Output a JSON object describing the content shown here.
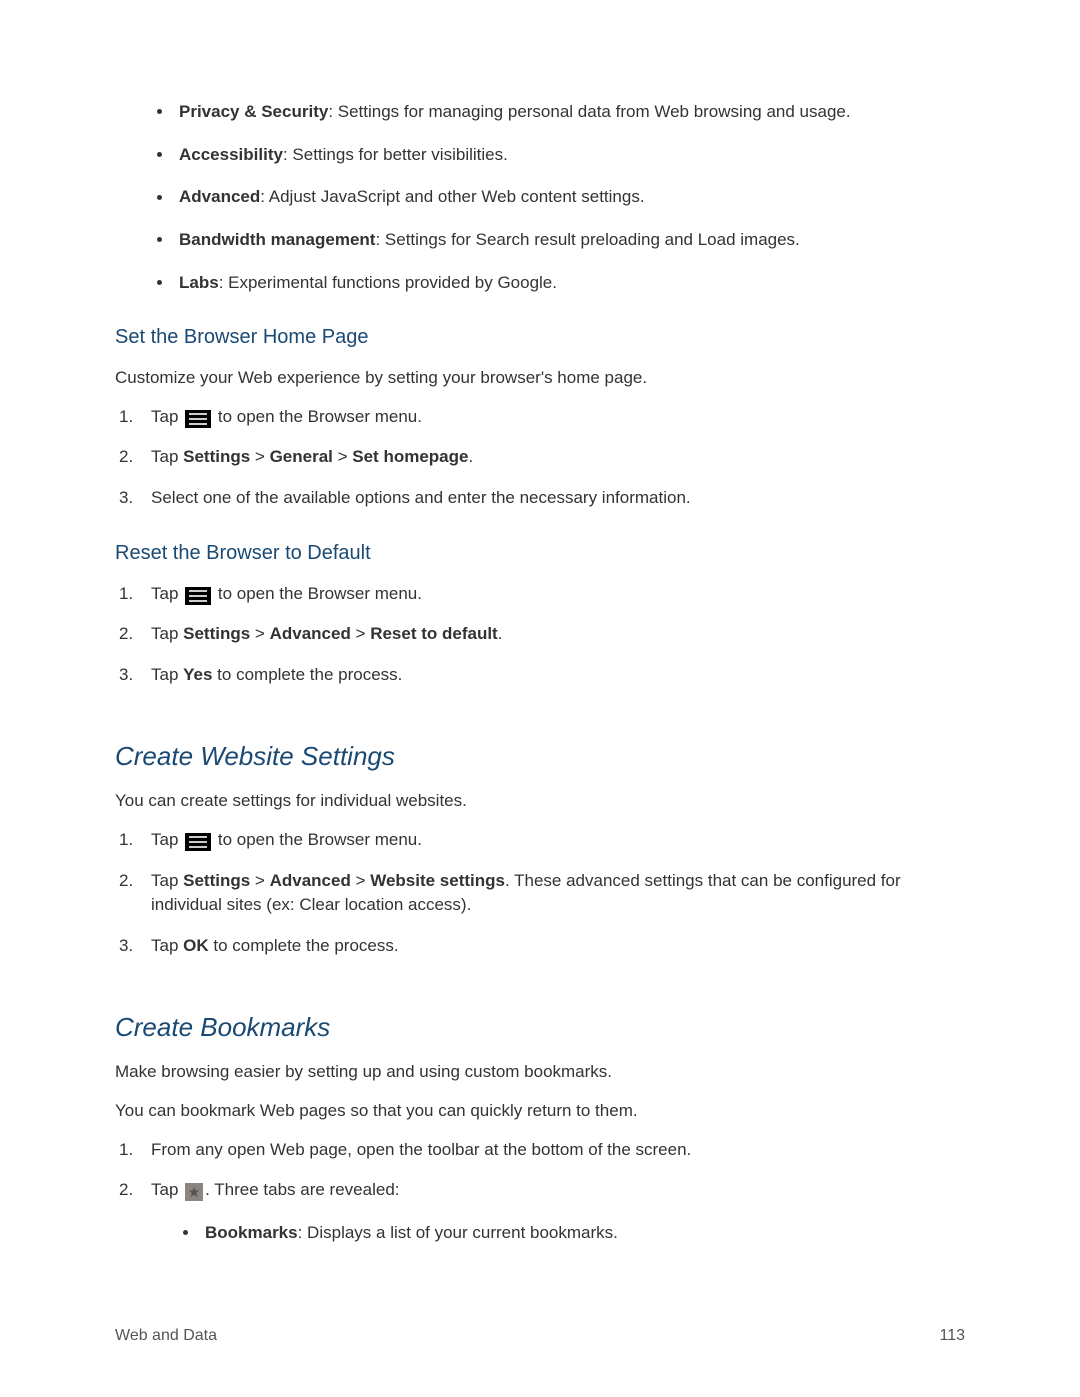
{
  "settings_list": [
    {
      "label": "Privacy & Security",
      "desc": ": Settings for managing personal data from Web browsing and usage."
    },
    {
      "label": "Accessibility",
      "desc": ": Settings for better visibilities."
    },
    {
      "label": "Advanced",
      "desc": ": Adjust JavaScript and other Web content settings."
    },
    {
      "label": "Bandwidth management",
      "desc": ": Settings for Search result preloading and Load images."
    },
    {
      "label": "Labs",
      "desc": ": Experimental functions provided by Google."
    }
  ],
  "section_homepage": {
    "heading": "Set the Browser Home Page",
    "intro": "Customize your Web experience by setting your browser's home page.",
    "steps": {
      "s1_pre": "Tap ",
      "s1_post": " to open the Browser menu.",
      "s2_pre": "Tap ",
      "s2_b1": "Settings",
      "s2_sep": " > ",
      "s2_b2": "General",
      "s2_b3": "Set homepage",
      "s2_post": ".",
      "s3": "Select one of the available options and enter the necessary information."
    }
  },
  "section_reset": {
    "heading": "Reset the Browser to Default",
    "steps": {
      "s1_pre": "Tap ",
      "s1_post": " to open the Browser menu.",
      "s2_pre": "Tap ",
      "s2_b1": "Settings",
      "s2_sep": " > ",
      "s2_b2": "Advanced",
      "s2_b3": "Reset to default",
      "s2_post": ".",
      "s3_pre": "Tap ",
      "s3_b1": "Yes",
      "s3_post": " to complete the process."
    }
  },
  "section_website": {
    "heading": "Create Website Settings",
    "intro": "You can create settings for individual websites.",
    "steps": {
      "s1_pre": "Tap ",
      "s1_post": " to open the Browser menu.",
      "s2_pre": "Tap ",
      "s2_b1": "Settings",
      "s2_sep": " > ",
      "s2_b2": "Advanced",
      "s2_b3": "Website settings",
      "s2_post": ". These advanced settings that can be configured for individual sites (ex: Clear location access).",
      "s3_pre": "Tap ",
      "s3_b1": "OK",
      "s3_post": " to complete the process."
    }
  },
  "section_bookmarks": {
    "heading": "Create Bookmarks",
    "intro1": "Make browsing easier by setting up and using custom bookmarks.",
    "intro2": "You can bookmark Web pages so that you can quickly return to them.",
    "steps": {
      "s1": "From any open Web page, open the toolbar at the bottom of the screen.",
      "s2_pre": "Tap ",
      "s2_post": ". Three tabs are revealed:",
      "tab1_label": "Bookmarks",
      "tab1_desc": ": Displays a list of your current bookmarks."
    }
  },
  "footer": {
    "section": "Web and Data",
    "page": "113"
  },
  "icons": {
    "menu": "menu-icon",
    "star": "bookmark-star-icon"
  }
}
